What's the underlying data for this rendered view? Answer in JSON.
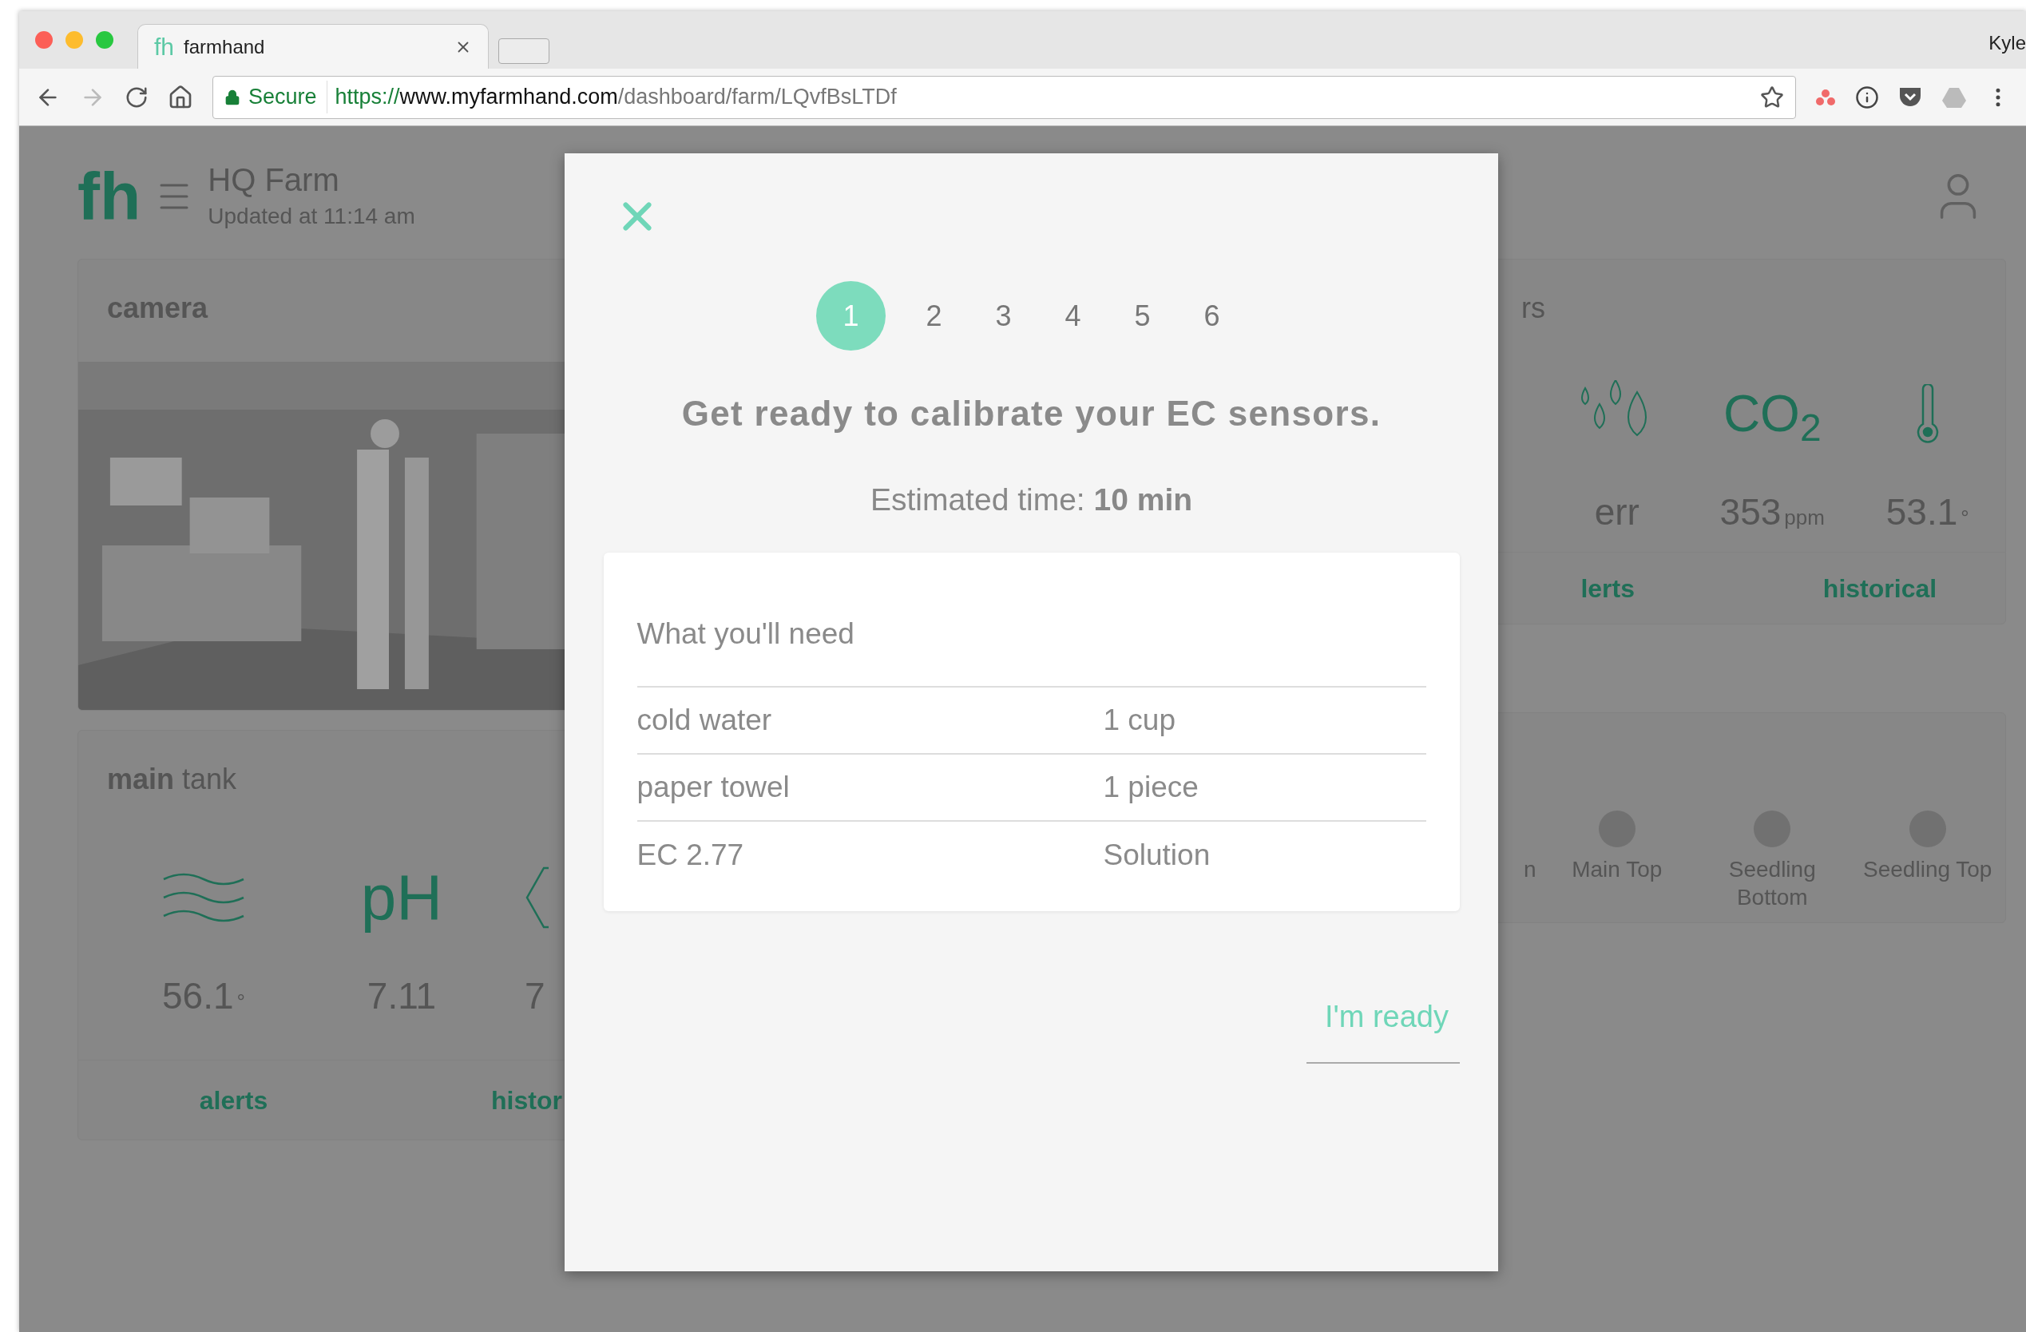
{
  "browser": {
    "tab": {
      "favicon": "fh",
      "title": "farmhand"
    },
    "secure": "Secure",
    "url": {
      "scheme": "https://",
      "host": "www.myfarmhand.com",
      "path": "/dashboard/farm/LQvfBsLTDf"
    },
    "profile": "Kyle"
  },
  "header": {
    "logo": "fh",
    "farm": "HQ Farm",
    "updated": "Updated at 11:14 am"
  },
  "camera": {
    "title": "camera"
  },
  "main_tank": {
    "title": "**main** tank",
    "readings": [
      {
        "kind": "waves",
        "value": "56.1",
        "unit": "°"
      },
      {
        "kind": "ph",
        "symbol": "pH",
        "value": "7.11"
      },
      {
        "kind": "hexagon",
        "value": "7"
      }
    ],
    "links": [
      "alerts",
      "histor"
    ]
  },
  "sensors": {
    "title": "rs",
    "readings": [
      {
        "kind": "hidden"
      },
      {
        "kind": "drops",
        "value": "err"
      },
      {
        "kind": "co2",
        "symbol": "CO$_{2}$",
        "value": "353",
        "unit": "ppm"
      },
      {
        "kind": "thermometer",
        "value": "53.1",
        "unit": "°"
      }
    ],
    "links": [
      "lerts",
      "historical"
    ]
  },
  "zones": [
    {
      "kind": "partial",
      "label": "n"
    },
    {
      "kind": "zone",
      "label": "Main Top"
    },
    {
      "kind": "zone",
      "label": "Seedling Bottom"
    },
    {
      "kind": "zone",
      "label": "Seedling Top"
    }
  ],
  "modal": {
    "steps": [
      {
        "label": "1",
        "selected": true
      },
      {
        "label": "2",
        "selected": false
      },
      {
        "label": "3",
        "selected": false
      },
      {
        "label": "4",
        "selected": false
      },
      {
        "label": "5",
        "selected": false
      },
      {
        "label": "6",
        "selected": false
      }
    ],
    "title": "Get ready to calibrate your EC sensors.",
    "estimate": "Estimated time: **10 min**",
    "needs": {
      "title": "What you'll need",
      "rows": [
        [
          "cold water",
          "1 cup"
        ],
        [
          "paper towel",
          "1 piece"
        ],
        [
          "EC 2.77",
          "Solution"
        ]
      ]
    },
    "action": "I'm ready"
  }
}
